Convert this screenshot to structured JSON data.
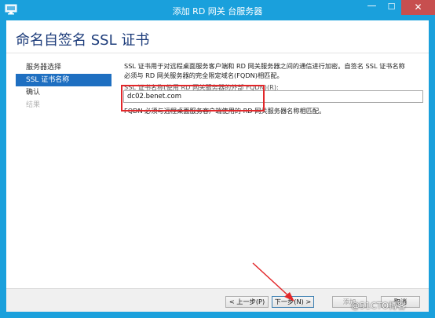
{
  "window": {
    "title": "添加 RD 网关 台服务器",
    "icon": "server-app-icon",
    "minimize_glyph": "—",
    "maximize_glyph": "☐",
    "close_glyph": "✕",
    "accent": "#1aa0dc",
    "close_color": "#c74f4f"
  },
  "page": {
    "title": "命名自签名 SSL 证书"
  },
  "nav": {
    "items": [
      {
        "label": "服务器选择",
        "state": "normal"
      },
      {
        "label": "SSL 证书名称",
        "state": "active"
      },
      {
        "label": "确认",
        "state": "normal"
      },
      {
        "label": "结果",
        "state": "disabled"
      }
    ],
    "active_color": "#1e6fc1"
  },
  "content": {
    "description_line1": "SSL 证书用于对远程桌面服务客户端和 RD 网关服务器之间的通信进行加密。自签名 SSL 证书名称",
    "description_line2": "必须与 RD 网关服务器的完全限定域名(FQDN)相匹配。",
    "field_label": "SSL 证书名称(使用 RD 网关服务器的外部 FQDN)(R):",
    "fqdn_value": "dc02.benet.com",
    "note": "FQDN 必须与远程桌面服务客户端使用的 RD 网关服务器名称相匹配。"
  },
  "footer": {
    "prev_label": "< 上一步(P)",
    "next_label": "下一步(N) >",
    "install_label": "添加",
    "cancel_label": "取消"
  },
  "annotation": {
    "highlight_color": "#e2272a"
  },
  "watermark": {
    "text": "@51CTO博客"
  }
}
